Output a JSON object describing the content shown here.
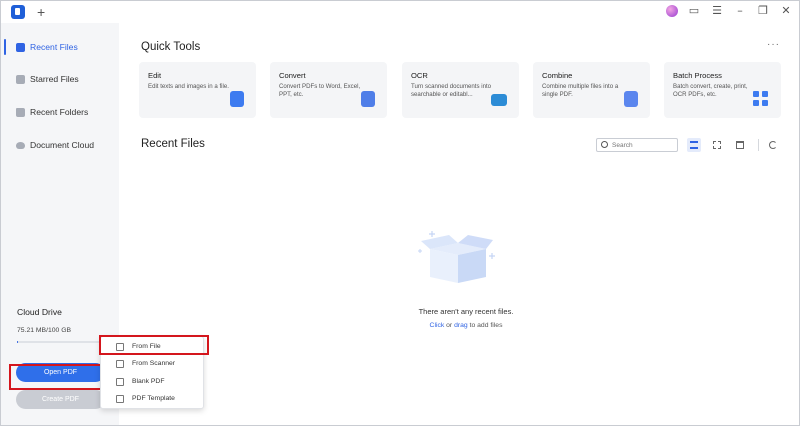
{
  "titlebar": {
    "new_tab": "+"
  },
  "sidebar": {
    "items": [
      {
        "label": "Recent Files",
        "icon": "recent-files-icon",
        "active": true
      },
      {
        "label": "Starred Files",
        "icon": "star-icon",
        "active": false
      },
      {
        "label": "Recent Folders",
        "icon": "folder-icon",
        "active": false
      },
      {
        "label": "Document Cloud",
        "icon": "cloud-icon",
        "active": false
      }
    ],
    "cloud_drive": {
      "title": "Cloud Drive",
      "usage": "75.21 MB/100 GB",
      "fraction_used": 0.0007
    },
    "open_pdf": "Open PDF",
    "create_pdf": "Create PDF"
  },
  "create_menu": {
    "items": [
      "From File",
      "From Scanner",
      "Blank PDF",
      "PDF Template"
    ]
  },
  "quick_tools": {
    "title": "Quick Tools",
    "more": "···",
    "cards": [
      {
        "title": "Edit",
        "desc": "Edit texts and images in a file."
      },
      {
        "title": "Convert",
        "desc": "Convert PDFs to Word, Excel, PPT, etc."
      },
      {
        "title": "OCR",
        "desc": "Turn scanned documents into searchable or editabl..."
      },
      {
        "title": "Combine",
        "desc": "Combine multiple files into a single PDF."
      },
      {
        "title": "Batch Process",
        "desc": "Batch convert, create, print, OCR PDFs, etc."
      }
    ]
  },
  "recent_files": {
    "title": "Recent Files",
    "search_placeholder": "Search",
    "empty_message": "There aren't any recent files.",
    "hint_click": "Click",
    "hint_or": "or",
    "hint_drag": "drag",
    "hint_rest": "to add files"
  },
  "colors": {
    "accent": "#2f63e3",
    "highlight_box": "#d4161d"
  }
}
